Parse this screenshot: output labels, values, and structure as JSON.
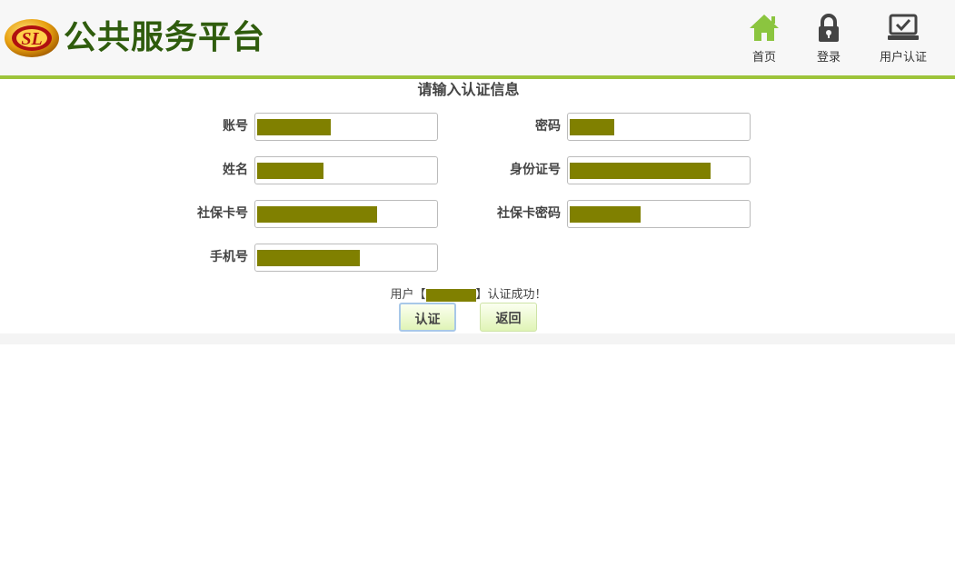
{
  "header": {
    "logo_text": "SL",
    "title": "公共服务平台",
    "nav": [
      {
        "label": "首页",
        "icon": "home-icon"
      },
      {
        "label": "登录",
        "icon": "lock-icon"
      },
      {
        "label": "用户认证",
        "icon": "laptop-check-icon"
      }
    ],
    "accent_color": "#9dc43a"
  },
  "form": {
    "title": "请输入认证信息",
    "fields": [
      {
        "label": "账号",
        "value": "[redacted]"
      },
      {
        "label": "密码",
        "value": "[redacted]"
      },
      {
        "label": "姓名",
        "value": "[redacted]"
      },
      {
        "label": "身份证号",
        "value": "[redacted]"
      },
      {
        "label": "社保卡号",
        "value": "[redacted]"
      },
      {
        "label": "社保卡密码",
        "value": "[redacted]"
      },
      {
        "label": "手机号",
        "value": "[redacted]"
      }
    ],
    "status_prefix": "用户【",
    "status_suffix": "】认证成功！",
    "buttons": {
      "submit": "认证",
      "back": "返回"
    }
  }
}
